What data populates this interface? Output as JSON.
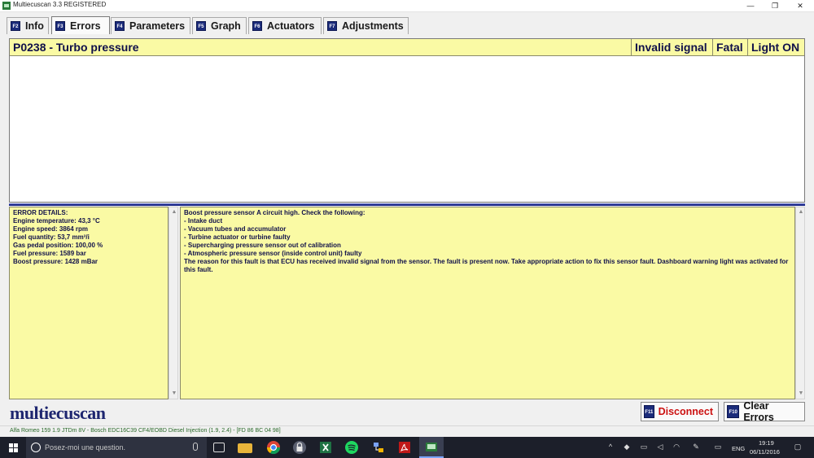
{
  "window": {
    "title": "Multiecuscan 3.3 REGISTERED",
    "min_glyph": "—",
    "max_glyph": "❐",
    "close_glyph": "✕"
  },
  "tabs": [
    {
      "key": "F2",
      "label": "Info",
      "active": false
    },
    {
      "key": "F3",
      "label": "Errors",
      "active": true
    },
    {
      "key": "F4",
      "label": "Parameters",
      "active": false
    },
    {
      "key": "F5",
      "label": "Graph",
      "active": false
    },
    {
      "key": "F6",
      "label": "Actuators",
      "active": false
    },
    {
      "key": "F7",
      "label": "Adjustments",
      "active": false
    }
  ],
  "error": {
    "code_title": "P0238 - Turbo pressure",
    "status": "Invalid signal",
    "severity": "Fatal",
    "light": "Light ON"
  },
  "details": {
    "lines": [
      "ERROR DETAILS:",
      "Engine temperature: 43,3 °C",
      "Engine speed: 3864 rpm",
      "Fuel quantity: 53,7 mm³/i",
      "Gas pedal position: 100,00 %",
      "Fuel pressure: 1589 bar",
      "Boost pressure: 1428 mBar"
    ]
  },
  "description": {
    "lines": [
      "Boost pressure sensor A circuit high. Check the following:",
      "- Intake duct",
      "- Vacuum tubes and accumulator",
      "- Turbine actuator or turbine faulty",
      "- Supercharging pressure sensor out of calibration",
      "- Atmospheric pressure sensor (inside control unit) faulty",
      "The reason for this fault is that ECU has received invalid signal from the sensor. The fault is present now. Take appropriate action to fix this sensor fault. Dashboard warning light was activated for this fault."
    ]
  },
  "brand": "multiecuscan",
  "buttons": {
    "disconnect": {
      "key": "F11",
      "label": "Disconnect"
    },
    "clear": {
      "key": "F10",
      "label": "Clear Errors"
    }
  },
  "status": {
    "vehicle": "Alfa Romeo 159 1.9 JTDm 8V - Bosch EDC16C39 CF4/EOBD Diesel Injection (1.9, 2.4) - [FD 86 BC 04 98]"
  },
  "taskbar": {
    "search_placeholder": "Posez-moi une question.",
    "lang": "ENG",
    "time": "19:19",
    "date": "06/11/2016",
    "icons": [
      "task-view-icon",
      "chrome-icon",
      "lock-app-icon",
      "file-explorer-icon",
      "excel-icon",
      "spotify-icon",
      "network-app-icon",
      "acrobat-icon",
      "multiecuscan-icon"
    ]
  },
  "colors": {
    "panel_yellow": "#fafaa4",
    "text_navy": "#10104a",
    "divider_blue": "#1e2a8a",
    "disconnect_red": "#cc1111"
  }
}
